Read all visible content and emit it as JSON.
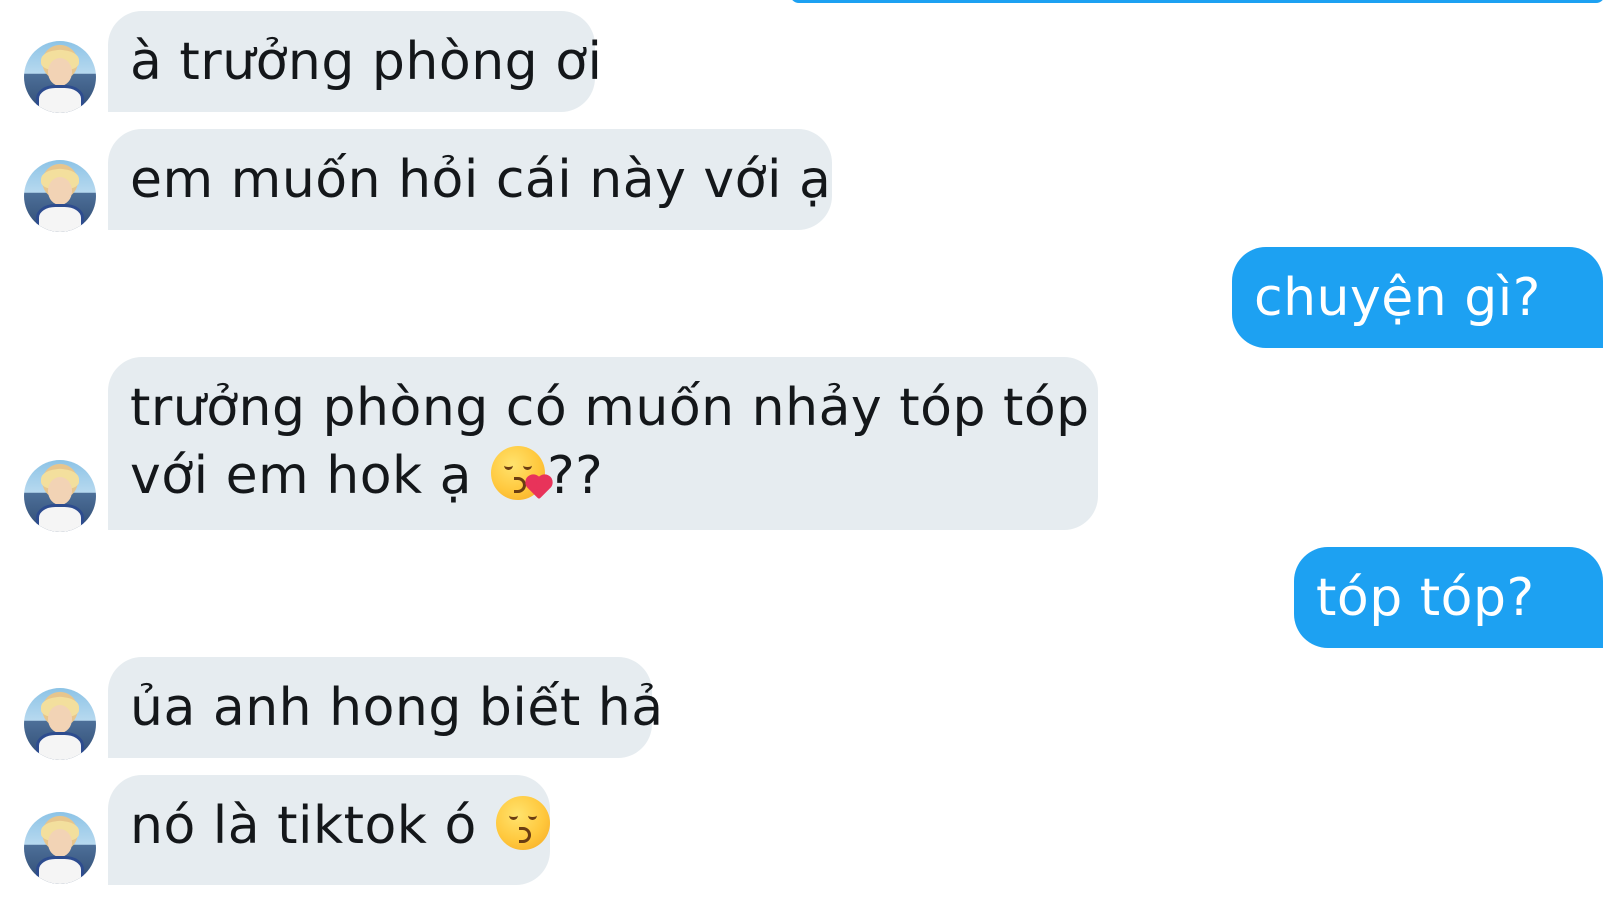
{
  "conversation": {
    "messages": [
      {
        "sender": "incoming",
        "text": "à trưởng phòng ơi"
      },
      {
        "sender": "incoming",
        "text": "em muốn hỏi cái này với ạ"
      },
      {
        "sender": "outgoing",
        "text": "chuyện gì?"
      },
      {
        "sender": "incoming",
        "text_line1": "trưởng phòng có muốn nhảy tóp tóp",
        "text_line2_before_emoji": "với em hok ạ ",
        "emoji": "face-blowing-a-kiss-icon",
        "text_line2_after_emoji": "??"
      },
      {
        "sender": "outgoing",
        "text": "tóp tóp?"
      },
      {
        "sender": "incoming",
        "text": "ủa anh hong biết hả"
      },
      {
        "sender": "incoming",
        "text_before_emoji": "nó là tiktok ó ",
        "emoji": "kissing-face-with-closed-eyes-icon"
      }
    ]
  },
  "colors": {
    "incoming_bubble": "#e6ecf0",
    "outgoing_bubble": "#1da1f2",
    "incoming_text": "#14171a",
    "outgoing_text": "#ffffff"
  }
}
